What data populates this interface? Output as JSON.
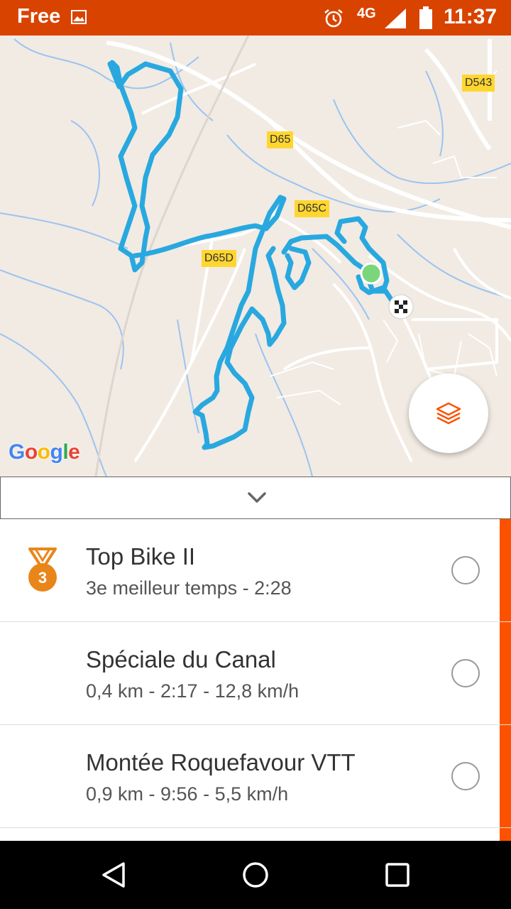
{
  "status_bar": {
    "carrier": "Free",
    "network": "4G",
    "time": "11:37",
    "icons": [
      "image-icon",
      "alarm-icon",
      "signal-icon",
      "battery-icon"
    ]
  },
  "map": {
    "road_labels": [
      "D543",
      "D65",
      "D65C",
      "D65D"
    ],
    "logo": [
      "G",
      "o",
      "o",
      "g",
      "l",
      "e"
    ],
    "route_color": "#29a8e0",
    "start_marker_color": "#7bd67b",
    "layers_icon": "layers-icon"
  },
  "collapse_icon": "chevron-down-icon",
  "segments": [
    {
      "title": "Top Bike II",
      "subtitle": "3e meilleur temps - 2:28",
      "rank": "3"
    },
    {
      "title": "Spéciale du Canal",
      "subtitle": "0,4 km - 2:17 - 12,8 km/h"
    },
    {
      "title": "Montée Roquefavour VTT",
      "subtitle": "0,9 km - 9:56 - 5,5 km/h"
    }
  ],
  "colors": {
    "status_bar": "#d94300",
    "accent": "#fc5200",
    "medal": "#e8861a"
  },
  "nav_bar": {
    "icons": [
      "back-icon",
      "home-icon",
      "recent-apps-icon"
    ]
  }
}
